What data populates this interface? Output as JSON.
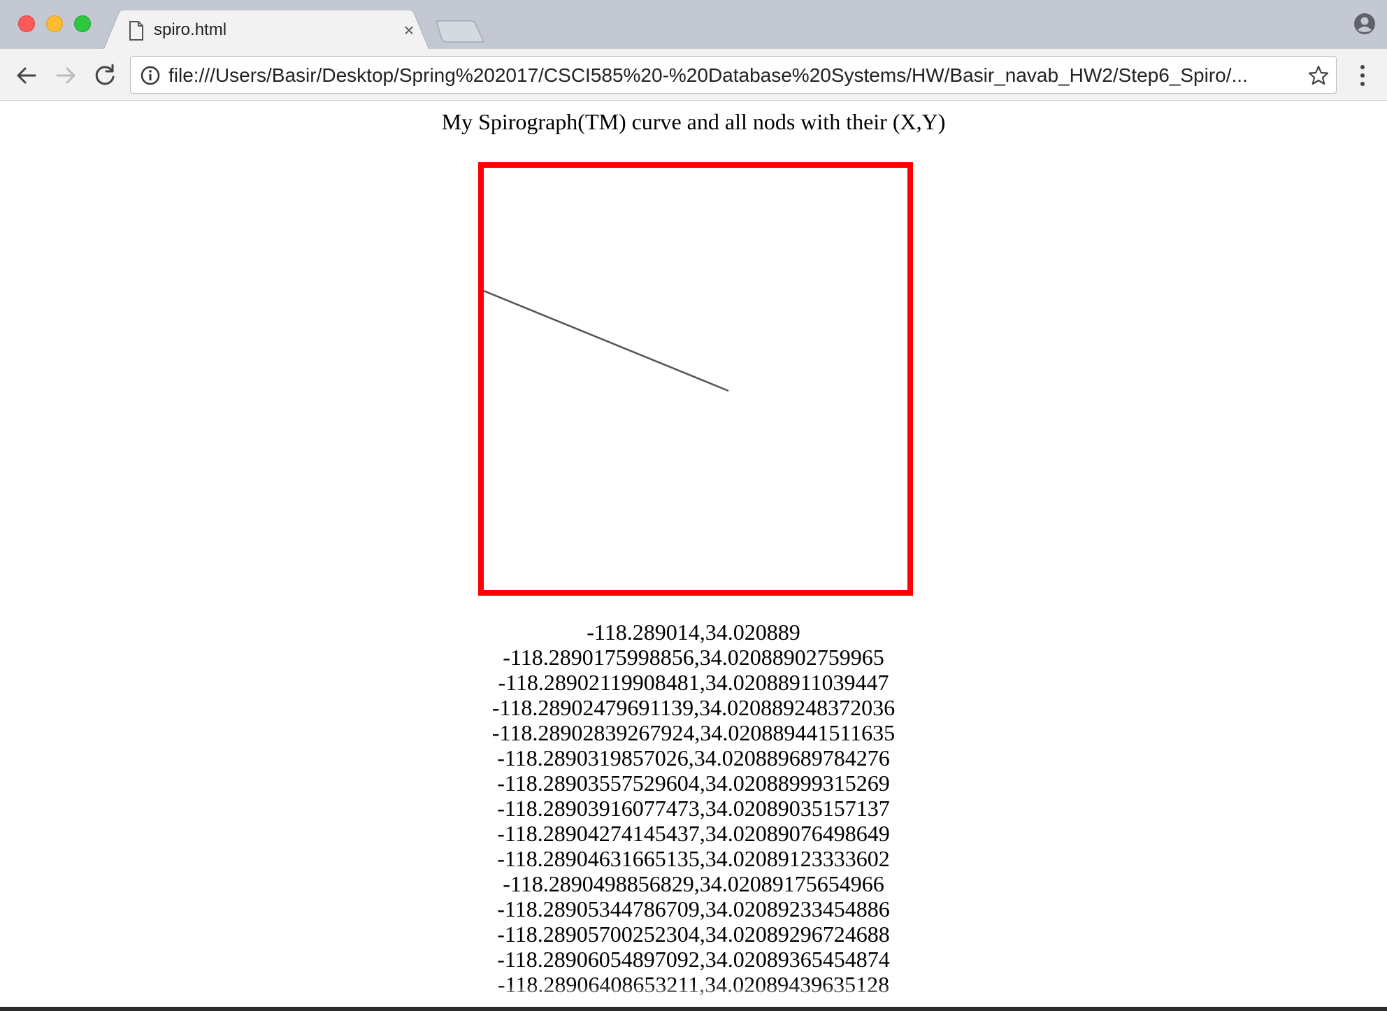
{
  "window": {
    "tab_title": "spiro.html",
    "tab_close_glyph": "×",
    "url": "file:///Users/Basir/Desktop/Spring%202017/CSCI585%20-%20Database%20Systems/HW/Basir_navab_HW2/Step6_Spiro/..."
  },
  "icons": {
    "tab": "document-icon",
    "back": "arrow-left-icon",
    "forward": "arrow-right-icon",
    "reload": "reload-icon",
    "info": "info-icon",
    "bookmark": "star-icon",
    "menu": "vertical-ellipsis-icon",
    "profile": "person-icon"
  },
  "colors": {
    "frame_border": "#ff0000",
    "curve_stroke": "#555555"
  },
  "page": {
    "heading": "My Spirograph(TM) curve and all nods with their (X,Y)",
    "coordinates": [
      "-118.289014,34.020889",
      "-118.2890175998856,34.02088902759965",
      "-118.28902119908481,34.02088911039447",
      "-118.28902479691139,34.020889248372036",
      "-118.28902839267924,34.020889441511635",
      "-118.2890319857026,34.020889689784276",
      "-118.28903557529604,34.02088999315269",
      "-118.28903916077473,34.02089035157137",
      "-118.28904274145437,34.02089076498649",
      "-118.28904631665135,34.02089123333602",
      "-118.2890498856829,34.02089175654966",
      "-118.28905344786709,34.02089233454886",
      "-118.28905700252304,34.02089296724688",
      "-118.28906054897092,34.02089365454874",
      "-118.28906408653211,34.02089439635128"
    ]
  }
}
